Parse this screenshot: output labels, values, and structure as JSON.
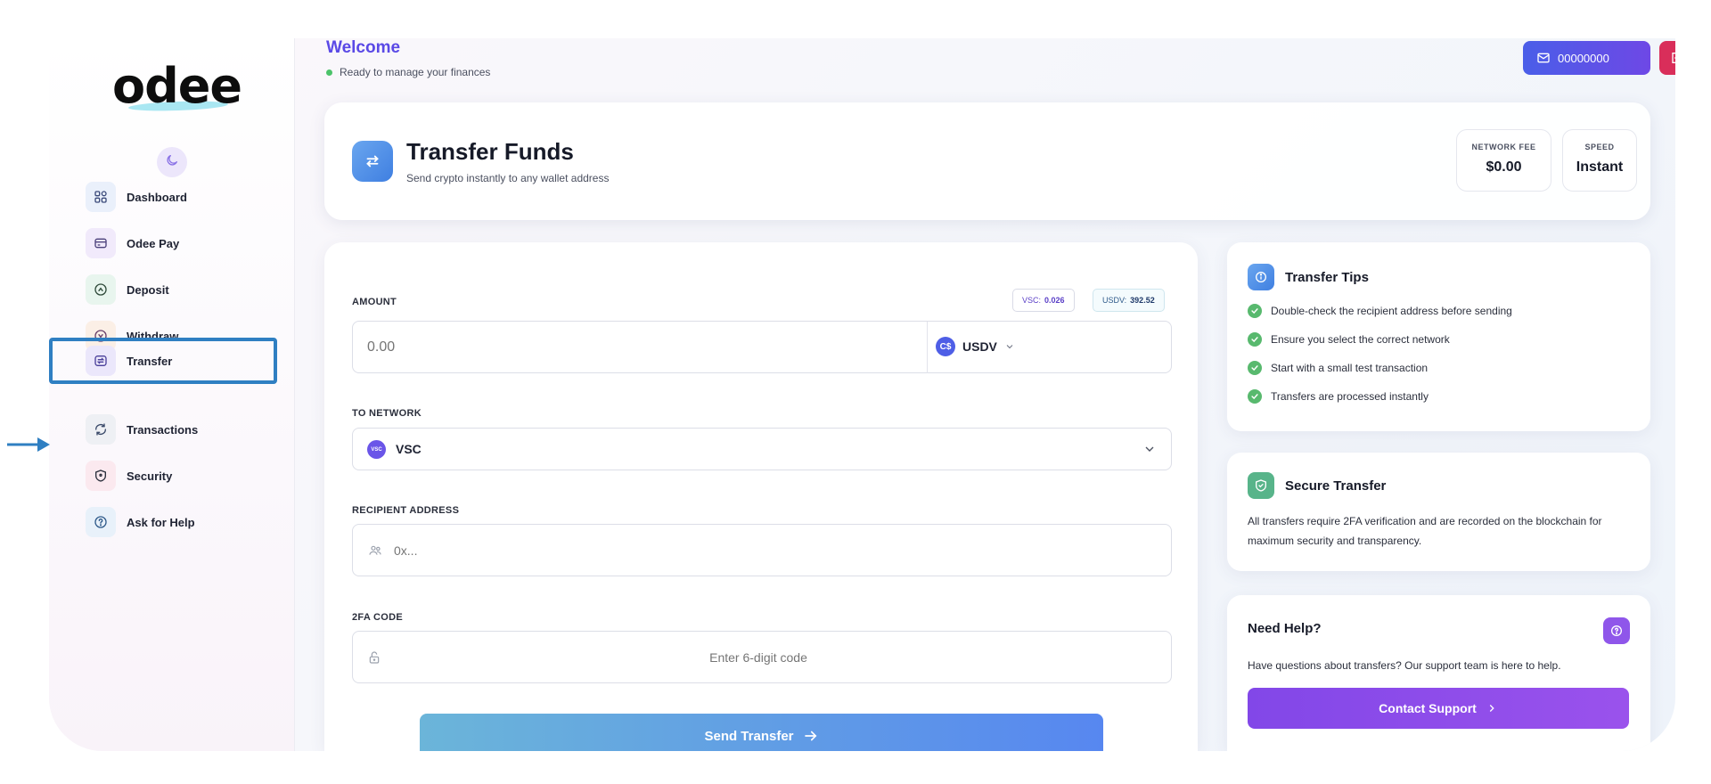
{
  "sidebar": {
    "logo": "odee",
    "items": [
      {
        "label": "Dashboard"
      },
      {
        "label": "Odee Pay"
      },
      {
        "label": "Deposit"
      },
      {
        "label": "Withdraw"
      },
      {
        "label": "Transfer"
      },
      {
        "label": "Transactions"
      },
      {
        "label": "Security"
      },
      {
        "label": "Ask for Help"
      }
    ]
  },
  "header": {
    "welcome": "Welcome",
    "status": "Ready to manage your finances",
    "account_number": "00000000"
  },
  "hero": {
    "title": "Transfer Funds",
    "subtitle": "Send crypto instantly to any wallet address",
    "fee_label": "NETWORK FEE",
    "fee_value": "$0.00",
    "speed_label": "SPEED",
    "speed_value": "Instant"
  },
  "form": {
    "amount_label": "AMOUNT",
    "balances": [
      {
        "symbol": "VSC:",
        "value": "0.026"
      },
      {
        "symbol": "USDV:",
        "value": "392.52"
      }
    ],
    "amount_placeholder": "0.00",
    "token": "USDV",
    "token_logo": "C$",
    "network_label": "TO NETWORK",
    "network_value": "VSC",
    "network_logo": "VSC",
    "recipient_label": "RECIPIENT ADDRESS",
    "recipient_placeholder": "0x...",
    "twofa_label": "2FA CODE",
    "twofa_placeholder": "Enter 6-digit code",
    "send_label": "Send Transfer"
  },
  "tips": {
    "title": "Transfer Tips",
    "items": [
      "Double-check the recipient address before sending",
      "Ensure you select the correct network",
      "Start with a small test transaction",
      "Transfers are processed instantly"
    ]
  },
  "secure": {
    "title": "Secure Transfer",
    "body": "All transfers require 2FA verification and are recorded on the blockchain for maximum security and transparency."
  },
  "help": {
    "title": "Need Help?",
    "body": "Have questions about transfers? Our support team is here to help.",
    "button": "Contact Support"
  },
  "colors": {
    "accent": "#5a49e6",
    "active_outline": "#2f7fc2",
    "logout": "#d92e5a",
    "success": "#58b96e"
  },
  "icons": [
    "dashboard-icon",
    "card-icon",
    "deposit-icon",
    "withdraw-icon",
    "transfer-icon",
    "transactions-icon",
    "shield-icon",
    "help-icon",
    "moon-icon",
    "mail-icon",
    "logout-icon",
    "swap-icon",
    "chevron-down-icon",
    "users-icon",
    "lock-icon",
    "arrow-right-icon",
    "info-icon",
    "check-icon",
    "chevron-right-icon"
  ]
}
